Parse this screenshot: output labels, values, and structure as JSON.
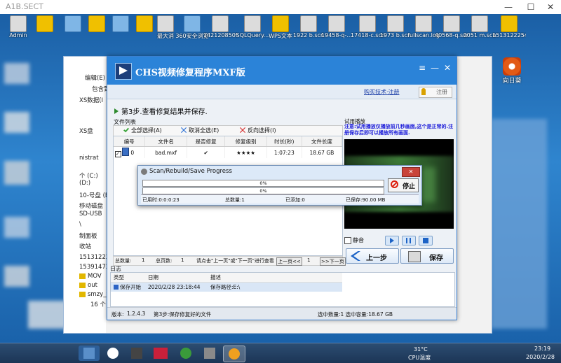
{
  "host": {
    "title": "A1B.SECT",
    "ctrl_min": "—",
    "ctrl_max": "☐",
    "ctrl_close": "✕"
  },
  "desktop_icons": [
    {
      "label": "Admin"
    },
    {
      "label": ""
    },
    {
      "label": ""
    },
    {
      "label": ""
    },
    {
      "label": ""
    },
    {
      "label": ""
    },
    {
      "label": "最大消"
    },
    {
      "label": "360安全浏览"
    },
    {
      "label": "1421208509"
    },
    {
      "label": "SQLQuery..."
    },
    {
      "label": "WPS文本"
    },
    {
      "label": "1922 b.scn"
    },
    {
      "label": "19458-q-..."
    },
    {
      "label": "17418-c.scn"
    },
    {
      "label": "1973 b.scn"
    },
    {
      "label": "fullscan.log"
    },
    {
      "label": "40568-q.scn"
    },
    {
      "label": "2051 m.scn"
    },
    {
      "label": "1513122254"
    }
  ],
  "right_app": {
    "label": "向日葵"
  },
  "explorer": {
    "menu_edit": "编辑(E)",
    "include": "包含到",
    "items": [
      "XS数据(I",
      "XS盘",
      "nistrat",
      "个 (C:)",
      "(D:)",
      "10-号盘 (E",
      "移动磁盘",
      "SD-USB",
      "\\",
      "制面板",
      "收站",
      "1513122254",
      "1539147209",
      "MOV",
      "out",
      "smzy_wenjia"
    ],
    "count": "16 个"
  },
  "app": {
    "title": "CHS视频修复程序MXF版",
    "ctl_menu": "≡",
    "ctl_min": "—",
    "ctl_close": "✕",
    "buy_link": "购买技术·注册",
    "register": "注册",
    "step": "第3步.查看修复结果并保存.",
    "file_list_label": "文件列表",
    "select_all": "全部选择(A)",
    "deselect_all": "取消全选(E)",
    "invert_select": "反向选择(I)",
    "columns": [
      "编号",
      "文件名",
      "是否修复",
      "修复级别",
      "时长(秒)",
      "文件长度"
    ],
    "row": {
      "num": "0",
      "file": "bad.mxf",
      "fixed": "✔",
      "level": "★★★★",
      "duration": "1:07:23",
      "size": "18.67 GB"
    },
    "pager": {
      "total_label": "总数量:",
      "total": "1",
      "pages_label": "总页数:",
      "pages": "1",
      "hint": "请点击\"上一页\"或\"下一页\"进行查看",
      "prev": "上一页<<",
      "page": "1",
      "next": ">>下一页"
    },
    "preview_label": "试用播放",
    "preview_note": "注意:试用播放仅播放前几秒画面,这个是正常的.注册保存后即可以播放所有画面.",
    "mute": "静音",
    "prev_step": "上一步",
    "save": "保存",
    "log_label": "日志",
    "log_columns": [
      "类型",
      "日期",
      "描述"
    ],
    "log_row": {
      "type": "保存开始",
      "date": "2020/2/28 23:18:44",
      "desc": "保存路径:E:\\"
    },
    "status": {
      "version_label": "版本:",
      "version": "1.2.4.3",
      "step": "第3步:保存修复好的文件",
      "selected": "选中数量:1 选中容量:18.67 GB"
    }
  },
  "dialog": {
    "title": "Scan/Rebuild/Save Progress",
    "close": "✕",
    "bar1": "0%",
    "bar2": "0%",
    "progress1": 0.0,
    "progress2": 0.0,
    "stop": "停止",
    "elapsed": "已用时:0:0:0:23",
    "total": "总数量:1",
    "added": "已添加:0",
    "saved": "已保存:90.00 MB"
  },
  "tray": {
    "temp": "31°C",
    "temp_label": "CPU温度",
    "time": "23:19",
    "date": "2020/2/28"
  },
  "colors": {
    "accent": "#2b83d8",
    "header_dark": "#1c3556"
  }
}
